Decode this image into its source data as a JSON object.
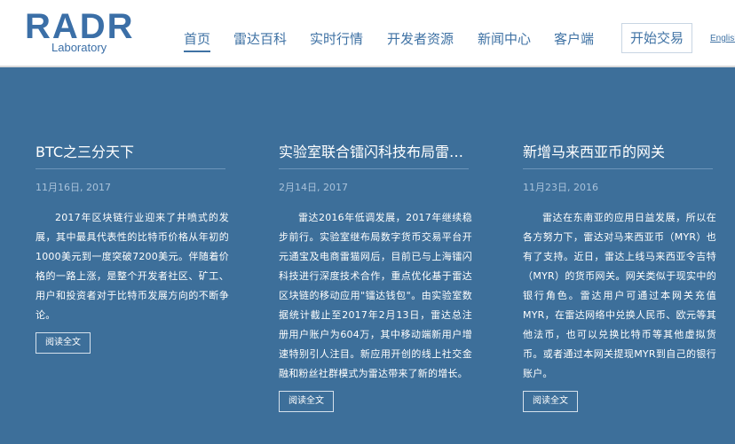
{
  "header": {
    "logo_main": "RADR",
    "logo_sub": "Laboratory",
    "nav": [
      "首页",
      "雷达百科",
      "实时行情",
      "开发者资源",
      "新闻中心",
      "客户端"
    ],
    "trade_button": "开始交易",
    "language_link": "English"
  },
  "articles": [
    {
      "title": "BTC之三分天下",
      "date": "11月16日, 2017",
      "body": "2017年区块链行业迎来了井喷式的发展，其中最具代表性的比特币价格从年初的1000美元到一度突破7200美元。伴随着价格的一路上涨，是整个开发者社区、矿工、用户和投资者对于比特币发展方向的不断争论。",
      "read_more": "阅读全文"
    },
    {
      "title": "实验室联合镭闪科技布局雷达钱包",
      "date": "2月14日, 2017",
      "body": "雷达2016年低调发展，2017年继续稳步前行。实验室继布局数字货币交易平台开元通宝及电商雷猫网后，目前已与上海镭闪科技进行深度技术合作，重点优化基于雷达区块链的移动应用\"镭达钱包\"。由实验室数据统计截止至2017年2月13日，雷达总注册用户账户为604万，其中移动端新用户增速特别引人注目。新应用开创的线上社交金融和粉丝社群模式为雷达带来了新的增长。",
      "read_more": "阅读全文"
    },
    {
      "title": "新增马来西亚币的网关",
      "date": "11月23日, 2016",
      "body": "雷达在东南亚的应用日益发展，所以在各方努力下，雷达对马来西亚币（MYR）也有了支持。近日，雷达上线马来西亚令吉特（MYR）的货币网关。网关类似于现实中的银行角色。雷达用户可通过本网关充值MYR，在雷达网络中兑换人民币、欧元等其他法币，也可以兑换比特币等其他虚拟货币。或者通过本网关提现MYR到自己的银行账户。",
      "read_more": "阅读全文"
    }
  ]
}
